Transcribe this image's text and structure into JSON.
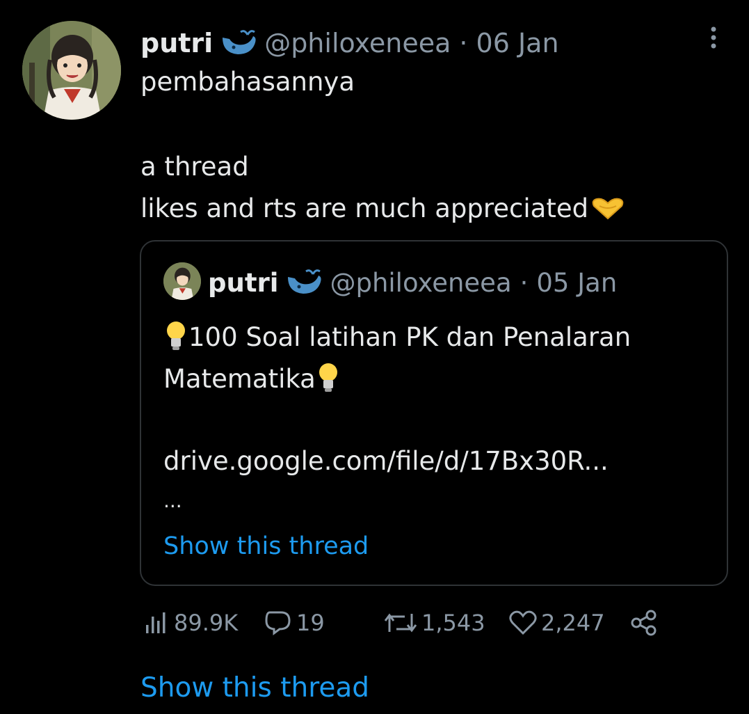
{
  "tweet": {
    "author_name": "putri",
    "handle": "@philoxeneea",
    "separator": "·",
    "date": "06 Jan",
    "lines": [
      "pembahasannya",
      "a thread",
      "likes and rts are much appreciated"
    ],
    "emoji_heart": "heart-hands-emoji",
    "more_icon": "more-vertical-icon"
  },
  "quoted": {
    "author_name": "putri",
    "handle": "@philoxeneea",
    "separator": "·",
    "date": "05 Jan",
    "line1": "100 Soal latihan PK dan Penalaran",
    "line2": "Matematika",
    "link": "drive.google.com/file/d/17Bx30R...",
    "ellipsis": "...",
    "show_thread": "Show this thread",
    "emoji": "light-bulb-emoji"
  },
  "actions": {
    "views": "89.9K",
    "replies": "19",
    "retweets": "1,543",
    "likes": "2,247"
  },
  "show_thread": "Show this thread",
  "colors": {
    "background": "#000000",
    "text": "#e7e9ea",
    "secondary": "#8b98a5",
    "link": "#1d9bf0",
    "border": "#2f3336",
    "whale": "#4a90c8"
  }
}
